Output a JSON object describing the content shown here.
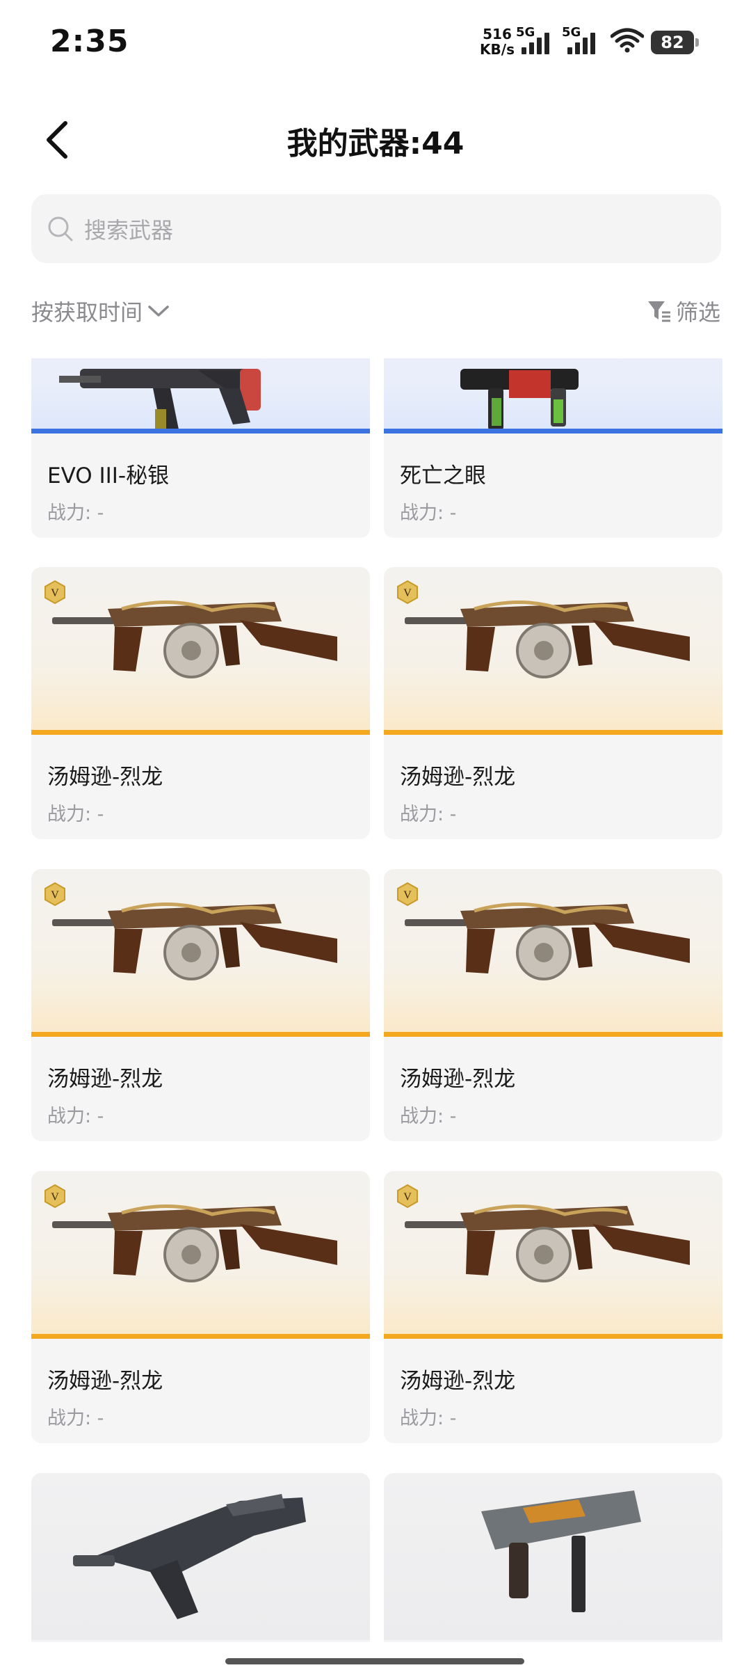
{
  "status_bar": {
    "time": "2:35",
    "net_speed_value": "516",
    "net_speed_unit": "KB/s",
    "sim1_tag": "5G",
    "sim2_tag": "5G",
    "battery": "82"
  },
  "header": {
    "title": "我的武器:44",
    "back_icon": "chevron-left-icon"
  },
  "search": {
    "placeholder": "搜索武器",
    "icon": "search-icon"
  },
  "toolbar": {
    "sort_label": "按获取时间",
    "filter_label": "筛选"
  },
  "colors": {
    "gold_rarity": "#f4a81f",
    "blue_rarity": "#3b73e0",
    "card_bg": "#f5f5f6",
    "muted_text": "#8a8a8f"
  },
  "weapons": [
    {
      "name": "EVO III-秘银",
      "power": "战力: -",
      "rarity": "blue"
    },
    {
      "name": "死亡之眼",
      "power": "战力: -",
      "rarity": "blue"
    },
    {
      "name": "汤姆逊-烈龙",
      "power": "战力: -",
      "rarity": "gold"
    },
    {
      "name": "汤姆逊-烈龙",
      "power": "战力: -",
      "rarity": "gold"
    },
    {
      "name": "汤姆逊-烈龙",
      "power": "战力: -",
      "rarity": "gold"
    },
    {
      "name": "汤姆逊-烈龙",
      "power": "战力: -",
      "rarity": "gold"
    },
    {
      "name": "汤姆逊-烈龙",
      "power": "战力: -",
      "rarity": "gold"
    },
    {
      "name": "汤姆逊-烈龙",
      "power": "战力: -",
      "rarity": "gold"
    }
  ]
}
